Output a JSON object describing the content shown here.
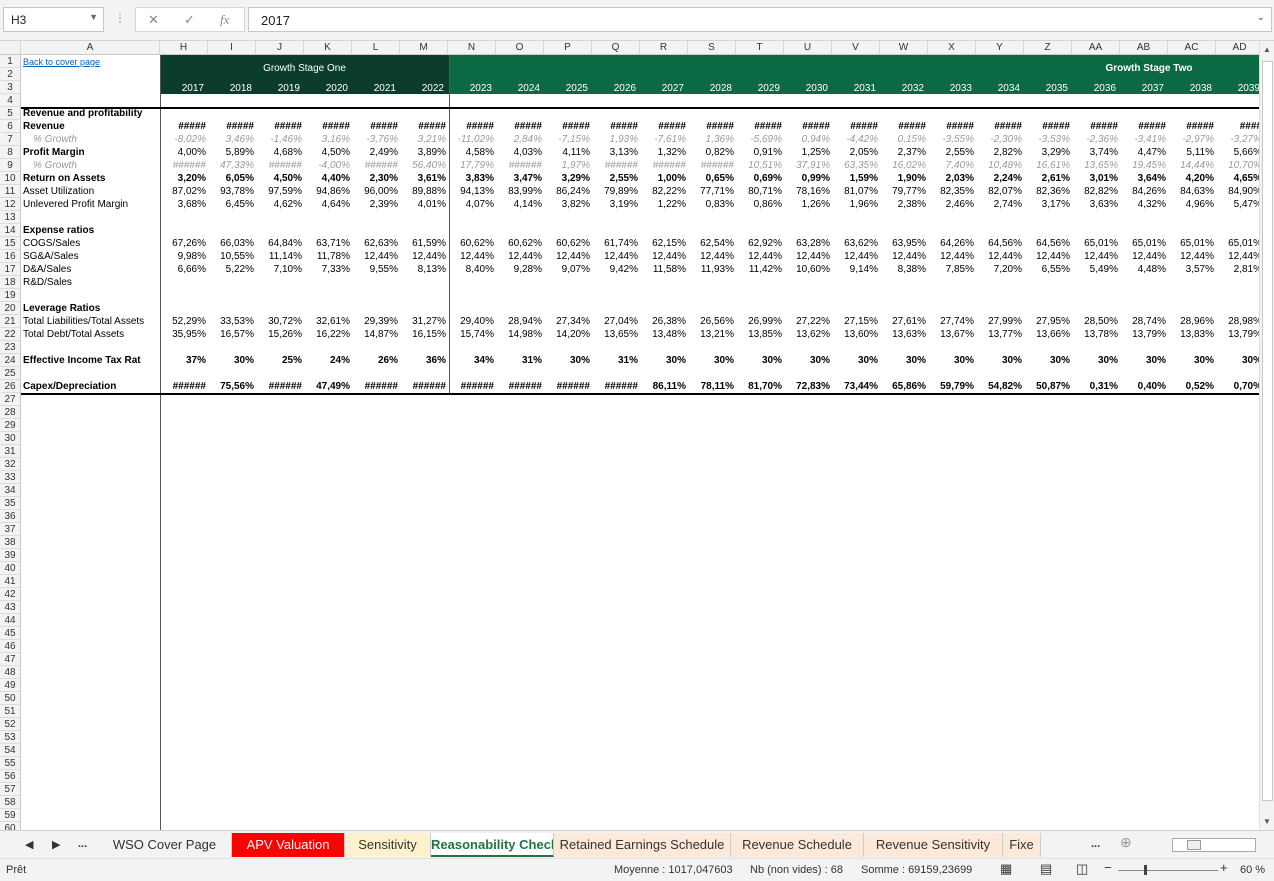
{
  "formula_bar": {
    "name_box": "H3",
    "formula": "2017",
    "cancel_icon": "✕",
    "confirm_icon": "✓",
    "fx_label": "fx",
    "dots": "⋮"
  },
  "columns": [
    "A",
    "H",
    "I",
    "J",
    "K",
    "L",
    "M",
    "N",
    "O",
    "P",
    "Q",
    "R",
    "S",
    "T",
    "U",
    "V",
    "W",
    "X",
    "Y",
    "Z",
    "AA",
    "AB",
    "AC",
    "AD"
  ],
  "link_text": "Back to cover page",
  "stage_one": "Growth Stage One",
  "stage_two": "Growth Stage Two",
  "years": [
    "2017",
    "2018",
    "2019",
    "2020",
    "2021",
    "2022",
    "2023",
    "2024",
    "2025",
    "2026",
    "2027",
    "2028",
    "2029",
    "2030",
    "2031",
    "2032",
    "2033",
    "2034",
    "2035",
    "2036",
    "2037",
    "2038",
    "2039"
  ],
  "rows": [
    {
      "row": 5,
      "label": "Revenue and profitability",
      "bold": true,
      "values": []
    },
    {
      "row": 6,
      "label": "Revenue",
      "bold": true,
      "values": [
        "#####",
        "#####",
        "#####",
        "#####",
        "#####",
        "#####",
        "#####",
        "#####",
        "#####",
        "#####",
        "#####",
        "#####",
        "#####",
        "#####",
        "#####",
        "#####",
        "#####",
        "#####",
        "#####",
        "#####",
        "#####",
        "#####",
        "####"
      ]
    },
    {
      "row": 7,
      "label": "% Growth",
      "gray": true,
      "values": [
        "-8,02%",
        "3,46%",
        "-1,46%",
        "3,16%",
        "-3,76%",
        "3,21%",
        "-11,02%",
        "2,84%",
        "-7,15%",
        "1,93%",
        "-7,61%",
        "1,36%",
        "-5,69%",
        "0,94%",
        "-4,42%",
        "0,15%",
        "-3,55%",
        "-2,30%",
        "-3,53%",
        "-2,36%",
        "-3,41%",
        "-2,97%",
        "-3,27%"
      ]
    },
    {
      "row": 8,
      "label": "Profit Margin",
      "bold": true,
      "values": [
        "4,00%",
        "5,89%",
        "4,68%",
        "4,50%",
        "2,49%",
        "3,89%",
        "4,58%",
        "4,03%",
        "4,11%",
        "3,13%",
        "1,32%",
        "0,82%",
        "0,91%",
        "1,25%",
        "2,05%",
        "2,37%",
        "2,55%",
        "2,82%",
        "3,29%",
        "3,74%",
        "4,47%",
        "5,11%",
        "5,66%"
      ]
    },
    {
      "row": 9,
      "label": "% Growth",
      "gray": true,
      "values": [
        "######",
        "47,33%",
        "######",
        "-4,00%",
        "######",
        "56,40%",
        "17,79%",
        "######",
        "1,97%",
        "######",
        "######",
        "######",
        "10,51%",
        "37,91%",
        "63,35%",
        "16,02%",
        "7,40%",
        "10,48%",
        "16,61%",
        "13,65%",
        "19,45%",
        "14,44%",
        "10,70%"
      ]
    },
    {
      "row": 10,
      "label": "Return on Assets",
      "bold": true,
      "bvals": true,
      "values": [
        "3,20%",
        "6,05%",
        "4,50%",
        "4,40%",
        "2,30%",
        "3,61%",
        "3,83%",
        "3,47%",
        "3,29%",
        "2,55%",
        "1,00%",
        "0,65%",
        "0,69%",
        "0,99%",
        "1,59%",
        "1,90%",
        "2,03%",
        "2,24%",
        "2,61%",
        "3,01%",
        "3,64%",
        "4,20%",
        "4,65%"
      ]
    },
    {
      "row": 11,
      "label": "Asset Utilization",
      "values": [
        "87,02%",
        "93,78%",
        "97,59%",
        "94,86%",
        "96,00%",
        "89,88%",
        "94,13%",
        "83,99%",
        "86,24%",
        "79,89%",
        "82,22%",
        "77,71%",
        "80,71%",
        "78,16%",
        "81,07%",
        "79,77%",
        "82,35%",
        "82,07%",
        "82,36%",
        "82,82%",
        "84,26%",
        "84,63%",
        "84,90%"
      ]
    },
    {
      "row": 12,
      "label": "Unlevered Profit Margin",
      "values": [
        "3,68%",
        "6,45%",
        "4,62%",
        "4,64%",
        "2,39%",
        "4,01%",
        "4,07%",
        "4,14%",
        "3,82%",
        "3,19%",
        "1,22%",
        "0,83%",
        "0,86%",
        "1,26%",
        "1,96%",
        "2,38%",
        "2,46%",
        "2,74%",
        "3,17%",
        "3,63%",
        "4,32%",
        "4,96%",
        "5,47%"
      ]
    },
    {
      "row": 14,
      "label": "Expense ratios",
      "bold": true,
      "values": []
    },
    {
      "row": 15,
      "label": "COGS/Sales",
      "values": [
        "67,26%",
        "66,03%",
        "64,84%",
        "63,71%",
        "62,63%",
        "61,59%",
        "60,62%",
        "60,62%",
        "60,62%",
        "61,74%",
        "62,15%",
        "62,54%",
        "62,92%",
        "63,28%",
        "63,62%",
        "63,95%",
        "64,26%",
        "64,56%",
        "64,56%",
        "65,01%",
        "65,01%",
        "65,01%",
        "65,01%"
      ]
    },
    {
      "row": 16,
      "label": "SG&A/Sales",
      "values": [
        "9,98%",
        "10,55%",
        "11,14%",
        "11,78%",
        "12,44%",
        "12,44%",
        "12,44%",
        "12,44%",
        "12,44%",
        "12,44%",
        "12,44%",
        "12,44%",
        "12,44%",
        "12,44%",
        "12,44%",
        "12,44%",
        "12,44%",
        "12,44%",
        "12,44%",
        "12,44%",
        "12,44%",
        "12,44%",
        "12,44%"
      ]
    },
    {
      "row": 17,
      "label": "D&A/Sales",
      "values": [
        "6,66%",
        "5,22%",
        "7,10%",
        "7,33%",
        "9,55%",
        "8,13%",
        "8,40%",
        "9,28%",
        "9,07%",
        "9,42%",
        "11,58%",
        "11,93%",
        "11,42%",
        "10,60%",
        "9,14%",
        "8,38%",
        "7,85%",
        "7,20%",
        "6,55%",
        "5,49%",
        "4,48%",
        "3,57%",
        "2,81%"
      ]
    },
    {
      "row": 18,
      "label": "R&D/Sales",
      "values": []
    },
    {
      "row": 20,
      "label": "Leverage Ratios",
      "bold": true,
      "values": []
    },
    {
      "row": 21,
      "label": "Total Liabilities/Total Assets",
      "values": [
        "52,29%",
        "33,53%",
        "30,72%",
        "32,61%",
        "29,39%",
        "31,27%",
        "29,40%",
        "28,94%",
        "27,34%",
        "27,04%",
        "26,38%",
        "26,56%",
        "26,99%",
        "27,22%",
        "27,15%",
        "27,61%",
        "27,74%",
        "27,99%",
        "27,95%",
        "28,50%",
        "28,74%",
        "28,96%",
        "28,98%"
      ]
    },
    {
      "row": 22,
      "label": "Total Debt/Total Assets",
      "values": [
        "35,95%",
        "16,57%",
        "15,26%",
        "16,22%",
        "14,87%",
        "16,15%",
        "15,74%",
        "14,98%",
        "14,20%",
        "13,65%",
        "13,48%",
        "13,21%",
        "13,85%",
        "13,62%",
        "13,60%",
        "13,63%",
        "13,67%",
        "13,77%",
        "13,66%",
        "13,78%",
        "13,79%",
        "13,83%",
        "13,79%"
      ]
    },
    {
      "row": 24,
      "label": "Effective Income Tax Rat",
      "bold": true,
      "bvals": true,
      "values": [
        "37%",
        "30%",
        "25%",
        "24%",
        "26%",
        "36%",
        "34%",
        "31%",
        "30%",
        "31%",
        "30%",
        "30%",
        "30%",
        "30%",
        "30%",
        "30%",
        "30%",
        "30%",
        "30%",
        "30%",
        "30%",
        "30%",
        "30%"
      ]
    },
    {
      "row": 26,
      "label": "Capex/Depreciation",
      "bold": true,
      "bvals": true,
      "values": [
        "######",
        "75,56%",
        "######",
        "47,49%",
        "######",
        "######",
        "######",
        "######",
        "######",
        "######",
        "86,11%",
        "78,11%",
        "81,70%",
        "72,83%",
        "73,44%",
        "65,86%",
        "59,79%",
        "54,82%",
        "50,87%",
        "0,31%",
        "0,40%",
        "0,52%",
        "0,70%"
      ]
    }
  ],
  "sheet_tabs": [
    {
      "label": "WSO Cover Page"
    },
    {
      "label": "APV Valuation",
      "color": "#ff0000"
    },
    {
      "label": "Sensitivity",
      "color": "#fff2cc"
    },
    {
      "label": "Reasonability Check",
      "active": true
    },
    {
      "label": "Retained Earnings Schedule",
      "color": "#fde9d9"
    },
    {
      "label": "Revenue Schedule",
      "color": "#fde9d9"
    },
    {
      "label": "Revenue Sensitivity",
      "color": "#fde9d9"
    },
    {
      "label": "Fixe",
      "color": "#fde9d9"
    }
  ],
  "tab_nav": {
    "prev": "◀",
    "next": "▶",
    "more": "...",
    "more_right": "...",
    "add": "⊕"
  },
  "status": {
    "ready": "Prêt",
    "average": "Moyenne : 1017,047603",
    "count": "Nb (non vides) : 68",
    "sum": "Somme : 69159,23699",
    "zoom": "60 %"
  }
}
